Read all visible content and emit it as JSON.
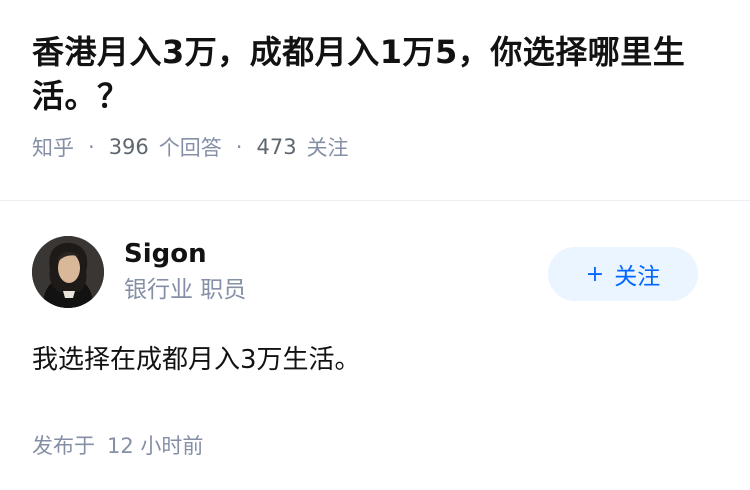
{
  "question": {
    "title": "香港月入3万，成都月入1万5，你选择哪里生活。？",
    "source": "知乎",
    "answer_count": "396",
    "answer_label": "个回答",
    "follow_count": "473",
    "follow_label": "关注"
  },
  "answer": {
    "author_name": "Sigon",
    "author_bio": "银行业 职员",
    "follow_button": "关注",
    "follow_plus": "+",
    "content": "我选择在成都月入3万生活。",
    "published_label": "发布于",
    "published_time": "12 小时前"
  },
  "colors": {
    "accent": "#0066ff",
    "button_bg": "#ebf5ff",
    "meta": "#8590a6"
  }
}
